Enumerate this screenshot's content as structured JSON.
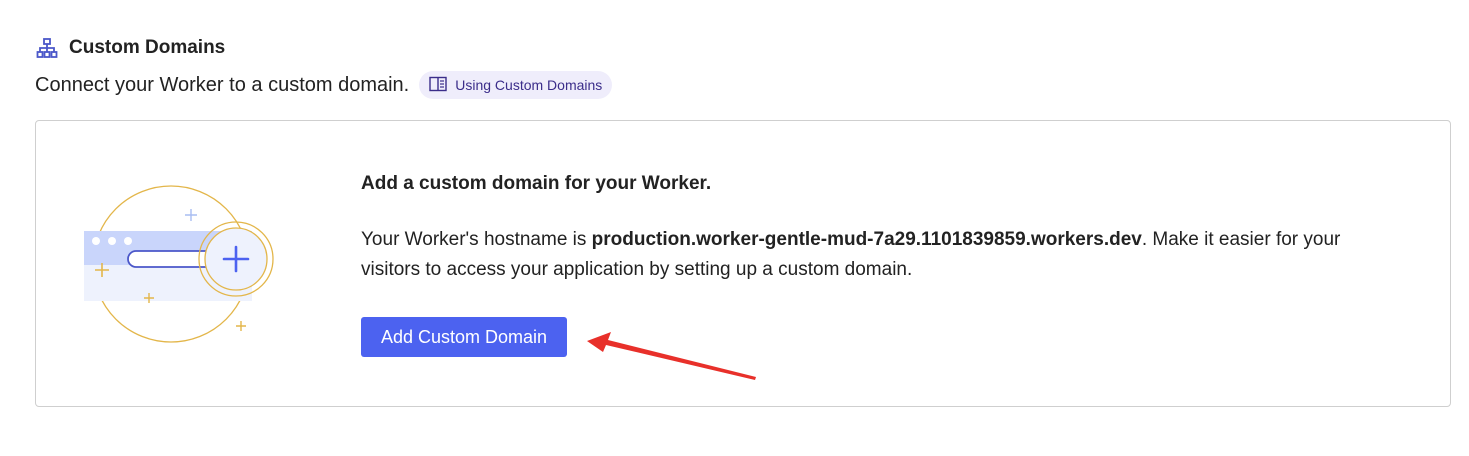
{
  "section": {
    "title": "Custom Domains",
    "subtitle": "Connect your Worker to a custom domain.",
    "doc_link_label": "Using Custom Domains"
  },
  "card": {
    "heading": "Add a custom domain for your Worker.",
    "desc_prefix": "Your Worker's hostname is ",
    "hostname": "production.worker-gentle-mud-7a29.1101839859.workers.dev",
    "desc_suffix": ". Make it easier for your visitors to access your application by setting up a custom domain.",
    "button_label": "Add Custom Domain"
  },
  "colors": {
    "accent": "#4c62f0",
    "link_bg": "#efedfb",
    "annotation": "#e8302a",
    "illustration_gold": "#e3b64a",
    "illustration_blue": "#c9d5fb"
  },
  "icons": {
    "section": "sitemap-icon",
    "doc_link": "book-icon",
    "add": "plus-icon"
  }
}
